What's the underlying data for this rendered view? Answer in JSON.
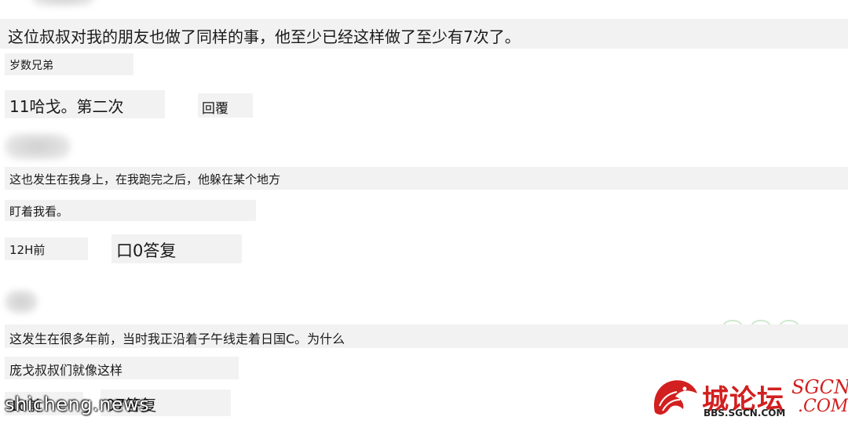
{
  "comments": [
    {
      "text": "这位叔叔对我的朋友也做了同样的事，他至少已经这样做了至少有7次了。",
      "author": "岁数兄弟",
      "meta": "11哈戈。第二次",
      "reply": "回覆"
    },
    {
      "text_line1": "这也发生在我身上，在我跑完之后，他躲在某个地方",
      "text_line2": "盯着我看。",
      "time": "12H前",
      "replies": "口0答复"
    },
    {
      "text_line1": "这发生在很多年前，当时我正沿着子午线走着日国C。为什么",
      "text_line2": "庞戈叔叔们就像这样",
      "time": "1d前",
      "replies": "07答复"
    }
  ],
  "watermark": {
    "site": "shicheng.news",
    "logo_cn": "城论坛",
    "logo_url": "BBS.SGCN.COM",
    "logo_sgcn": "SGCN",
    "logo_com": ".COM",
    "brand_color": "#d21f1f"
  }
}
